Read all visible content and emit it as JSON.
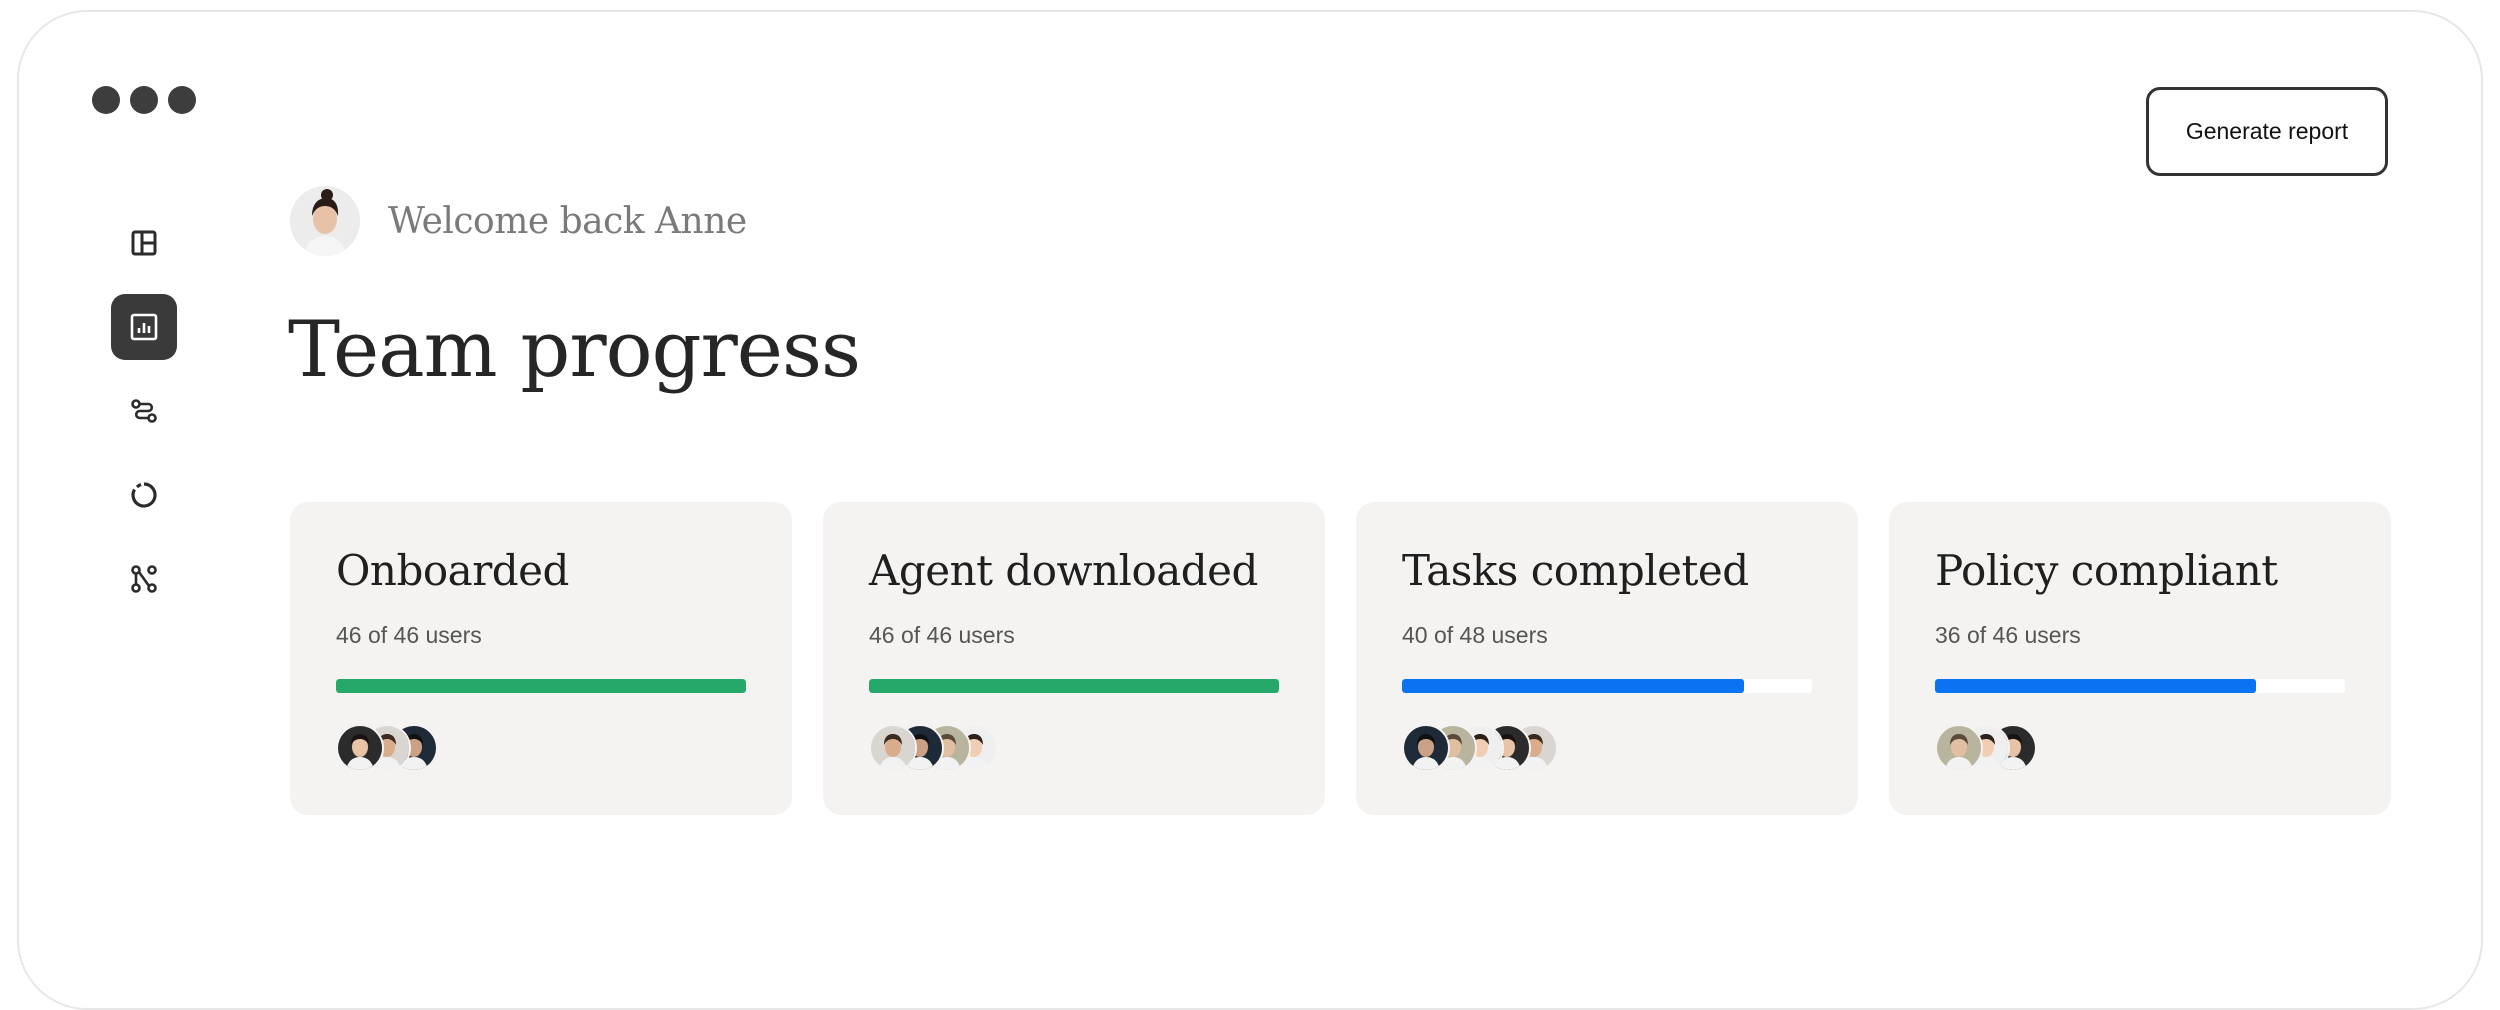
{
  "header": {
    "generate_report_label": "Generate report",
    "welcome_text": "Welcome back Anne",
    "page_title": "Team progress"
  },
  "sidebar": {
    "items": [
      {
        "icon": "layout-icon",
        "active": false
      },
      {
        "icon": "bar-chart-icon",
        "active": true
      },
      {
        "icon": "route-icon",
        "active": false
      },
      {
        "icon": "progress-ring-icon",
        "active": false
      },
      {
        "icon": "branch-icon",
        "active": false
      }
    ]
  },
  "colors": {
    "complete": "#27a86b",
    "partial": "#0a73f2",
    "card_bg": "#f4f3f1"
  },
  "cards": [
    {
      "title": "Onboarded",
      "subtitle": "46 of 46 users",
      "progress": 1.0,
      "color": "#27a86b",
      "avatar_count": 3
    },
    {
      "title": "Agent downloaded",
      "subtitle": "46 of 46 users",
      "progress": 1.0,
      "color": "#27a86b",
      "avatar_count": 4
    },
    {
      "title": "Tasks completed",
      "subtitle": "40 of 48 users",
      "progress": 0.833,
      "color": "#0a73f2",
      "avatar_count": 5
    },
    {
      "title": "Policy compliant",
      "subtitle": "36 of 46 users",
      "progress": 0.783,
      "color": "#0a73f2",
      "avatar_count": 3
    }
  ]
}
